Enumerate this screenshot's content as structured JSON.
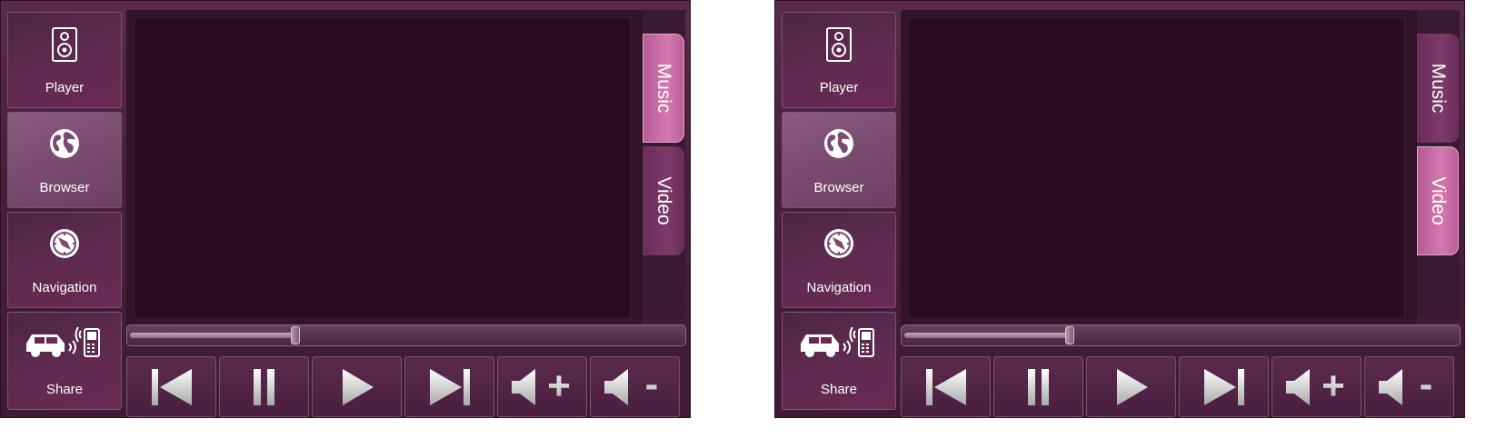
{
  "panels": [
    {
      "sidebar": {
        "player_label": "Player",
        "browser_label": "Browser",
        "navigation_label": "Navigation",
        "share_label": "Share",
        "active": "Browser"
      },
      "tabs": {
        "music_label": "Music",
        "video_label": "Video",
        "active": "Music"
      },
      "seek": {
        "progress": 0.3
      },
      "controls": {
        "volume_up_symbol": "+",
        "volume_down_symbol": "-"
      }
    },
    {
      "sidebar": {
        "player_label": "Player",
        "browser_label": "Browser",
        "navigation_label": "Navigation",
        "share_label": "Share",
        "active": "Browser"
      },
      "tabs": {
        "music_label": "Music",
        "video_label": "Video",
        "active": "Video"
      },
      "seek": {
        "progress": 0.3
      },
      "controls": {
        "volume_up_symbol": "+",
        "volume_down_symbol": "-"
      }
    }
  ],
  "icons": {
    "player": "speaker-icon",
    "browser": "globe-icon",
    "navigation": "compass-icon",
    "share": "car-phone-icon",
    "previous": "skip-previous-icon",
    "pause": "pause-icon",
    "play": "play-icon",
    "next": "skip-next-icon",
    "volume_up": "volume-up-icon",
    "volume_down": "volume-down-icon"
  },
  "colors": {
    "background": "#4a1f3e",
    "active_tab": "#d478b0",
    "screen": "#2a0c1f",
    "text": "#ffffff"
  }
}
